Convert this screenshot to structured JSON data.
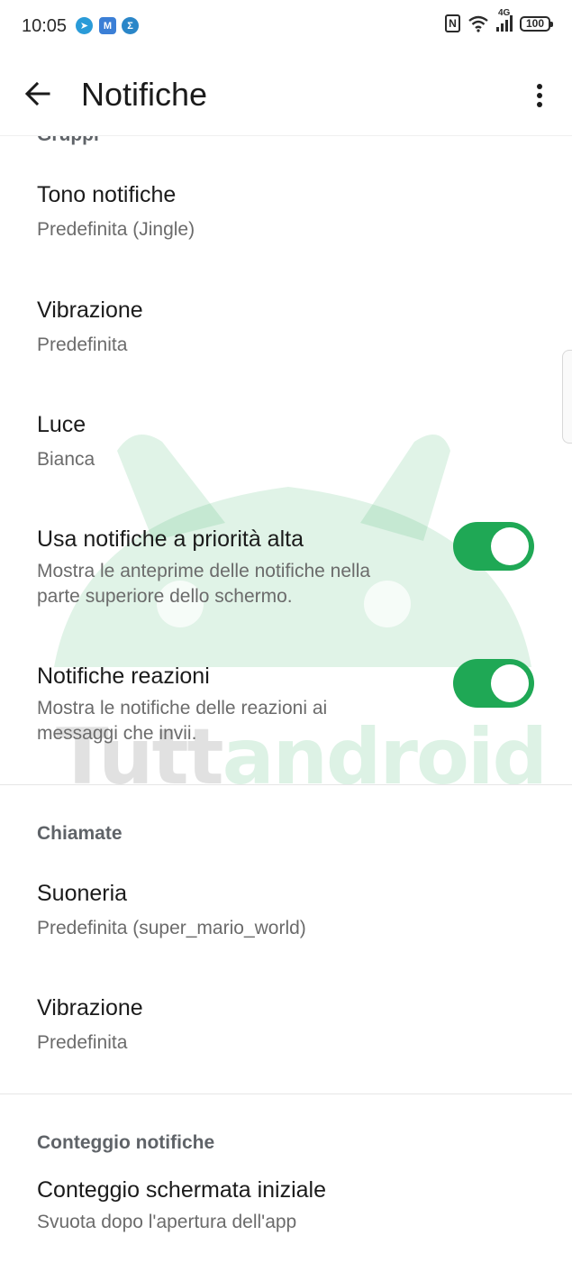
{
  "status_bar": {
    "time": "10:05",
    "network": "4G",
    "battery": "100"
  },
  "app_bar": {
    "title": "Notifiche"
  },
  "sections": {
    "gruppi": {
      "header": "Gruppi",
      "tono_title": "Tono notifiche",
      "tono_value": "Predefinita (Jingle)",
      "vibrazione_title": "Vibrazione",
      "vibrazione_value": "Predefinita",
      "luce_title": "Luce",
      "luce_value": "Bianca",
      "priorita_title": "Usa notifiche a priorità alta",
      "priorita_desc": "Mostra le anteprime delle notifiche nella parte superiore dello schermo.",
      "priorita_on": true,
      "reazioni_title": "Notifiche reazioni",
      "reazioni_desc": "Mostra le notifiche delle reazioni ai messaggi che invii.",
      "reazioni_on": true
    },
    "chiamate": {
      "header": "Chiamate",
      "suoneria_title": "Suoneria",
      "suoneria_value": "Predefinita (super_mario_world)",
      "vibrazione_title": "Vibrazione",
      "vibrazione_value": "Predefinita"
    },
    "conteggio": {
      "header": "Conteggio notifiche",
      "schermata_title": "Conteggio schermata iniziale",
      "schermata_value": "Svuota dopo l'apertura dell'app"
    }
  },
  "watermark": {
    "part1": "Tutt",
    "part2": "android"
  },
  "colors": {
    "toggle_on": "#1fa855",
    "section_header": "#5f6368"
  }
}
